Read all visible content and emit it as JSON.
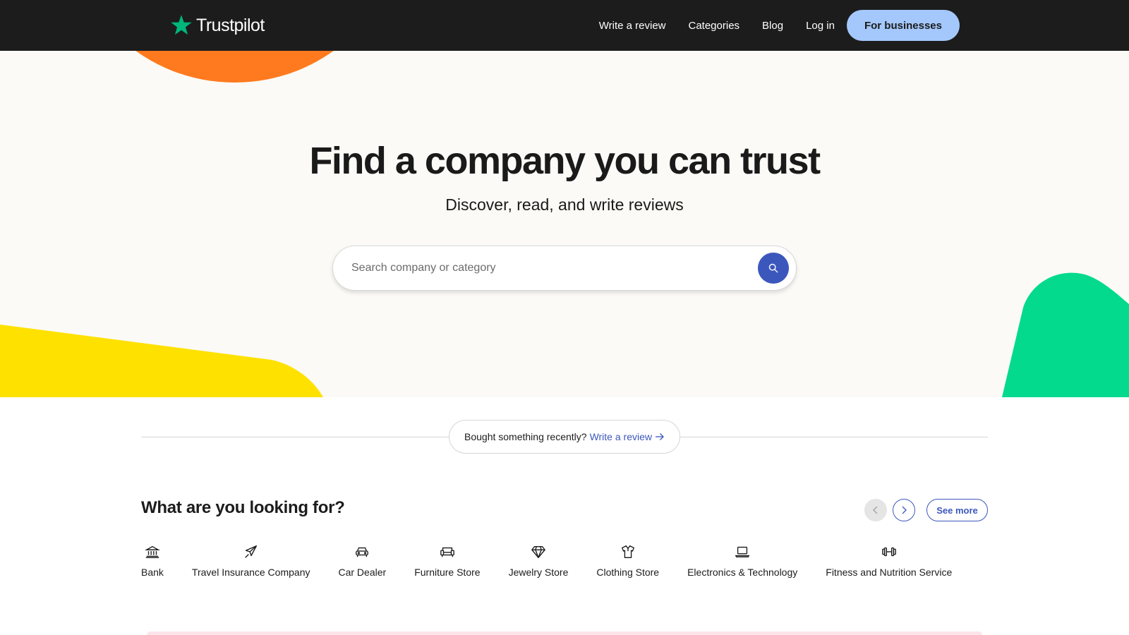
{
  "brand": {
    "name": "Trustpilot",
    "star_color": "#00b67a"
  },
  "nav": {
    "links": [
      "Write a review",
      "Categories",
      "Blog",
      "Log in"
    ],
    "cta": "For businesses"
  },
  "hero": {
    "title": "Find a company you can trust",
    "subtitle": "Discover, read, and write reviews",
    "search_placeholder": "Search company or category",
    "search_icon": "search-icon"
  },
  "review_prompt": {
    "question": "Bought something recently?",
    "link": "Write a review"
  },
  "categories": {
    "title": "What are you looking for?",
    "see_more": "See more",
    "items": [
      {
        "label": "Bank",
        "icon": "bank-icon"
      },
      {
        "label": "Travel Insurance Company",
        "icon": "airplane-icon"
      },
      {
        "label": "Car Dealer",
        "icon": "car-icon"
      },
      {
        "label": "Furniture Store",
        "icon": "sofa-icon"
      },
      {
        "label": "Jewelry Store",
        "icon": "diamond-icon"
      },
      {
        "label": "Clothing Store",
        "icon": "shirt-icon"
      },
      {
        "label": "Electronics & Technology",
        "icon": "laptop-icon"
      },
      {
        "label": "Fitness and Nutrition Service",
        "icon": "dumbbell-icon"
      }
    ]
  },
  "colors": {
    "nav_bg": "#1c1c1c",
    "cta_bg": "#a4c8fc",
    "accent_blue": "#3c57bc",
    "hero_bg": "#fbfaf6",
    "blob_orange": "#ff7a1f",
    "blob_yellow": "#ffe100",
    "blob_green": "#04da8d"
  }
}
